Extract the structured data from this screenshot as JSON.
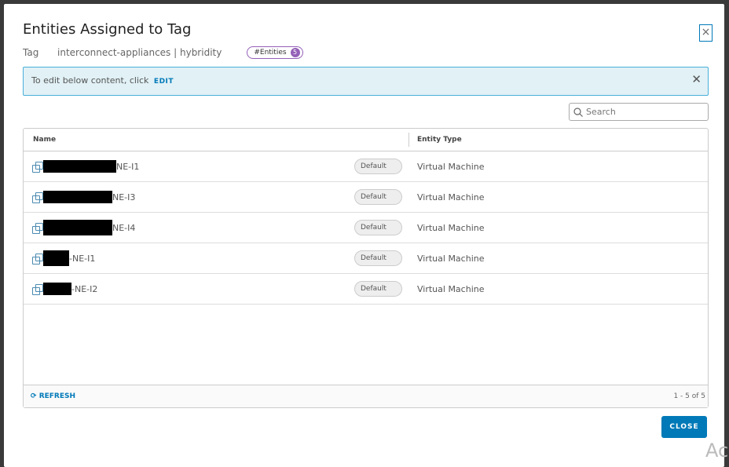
{
  "dialog": {
    "title": "Entities Assigned to Tag",
    "tag_label": "Tag",
    "tag_value": "interconnect-appliances | hybridity",
    "entities_badge": "#Entities",
    "entities_count": "5"
  },
  "alert": {
    "text": "To edit below content, click",
    "edit": "EDIT"
  },
  "search": {
    "placeholder": "Search"
  },
  "table": {
    "headers": [
      "Name",
      "Entity Type"
    ],
    "rows": [
      {
        "suffix": "NE-I1",
        "tag": "Default",
        "type": "Virtual Machine"
      },
      {
        "suffix": "NE-I3",
        "tag": "Default",
        "type": "Virtual Machine"
      },
      {
        "suffix": "NE-I4",
        "tag": "Default",
        "type": "Virtual Machine"
      },
      {
        "suffix": "-NE-I1",
        "tag": "Default",
        "type": "Virtual Machine"
      },
      {
        "suffix": "-NE-I2",
        "tag": "Default",
        "type": "Virtual Machine"
      }
    ],
    "refresh": "REFRESH",
    "pagination": "1 - 5 of 5"
  },
  "close_label": "CLOSE",
  "watermark": "Ac"
}
